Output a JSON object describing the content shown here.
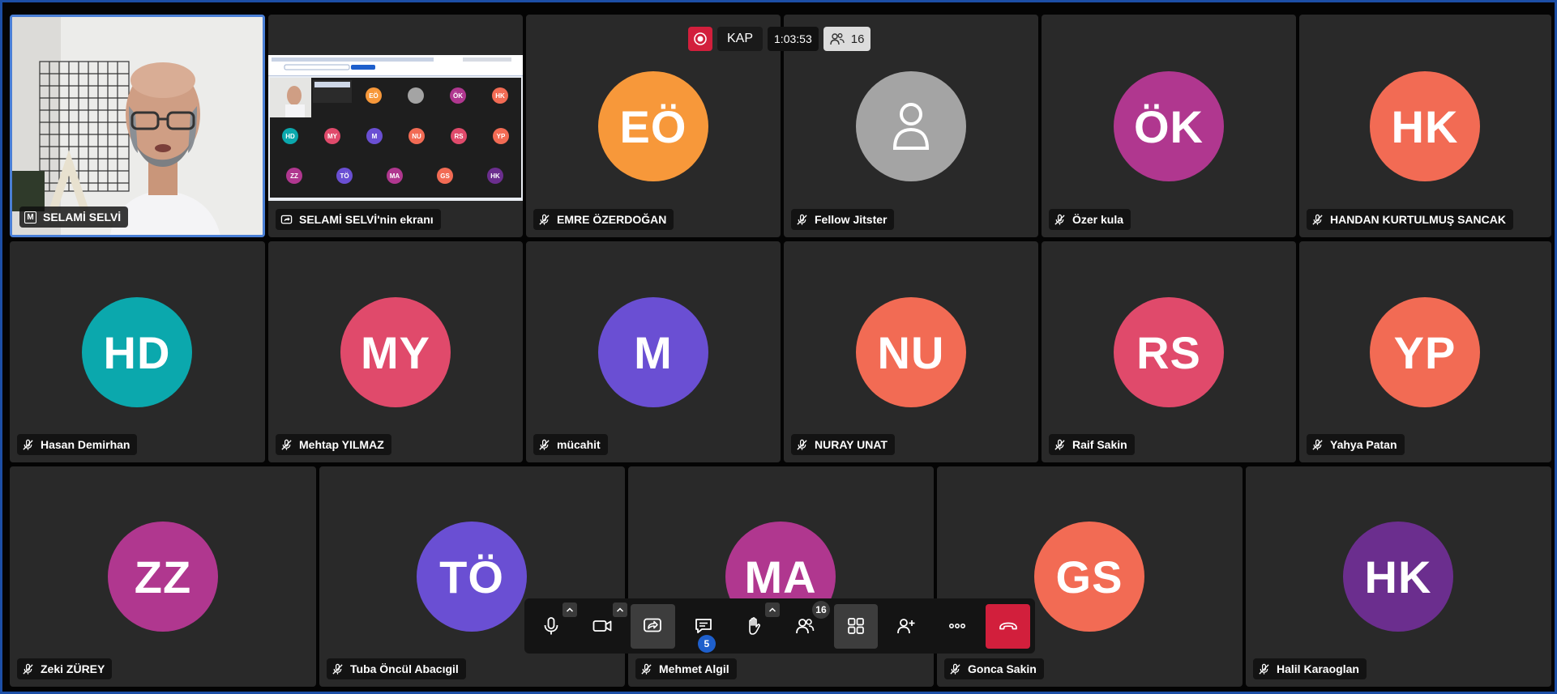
{
  "topbar": {
    "recording_label": "KAP",
    "elapsed": "1:03:53",
    "participant_count": "16"
  },
  "participants": [
    {
      "name": "SELAMİ SELVİ",
      "video": true
    },
    {
      "name": "SELAMİ SELVİ'nin ekranı",
      "screen_share": true
    },
    {
      "name": "EMRE ÖZERDOĞAN",
      "initials": "EÖ",
      "color": "#f7983a"
    },
    {
      "name": "Fellow Jitster",
      "placeholder": true,
      "color": "#a4a4a4"
    },
    {
      "name": "Özer kula",
      "initials": "ÖK",
      "color": "#b0378f"
    },
    {
      "name": "HANDAN KURTULMUŞ SANCAK",
      "initials": "HK",
      "color": "#f26b54"
    },
    {
      "name": "Hasan Demirhan",
      "initials": "HD",
      "color": "#0ba8ad"
    },
    {
      "name": "Mehtap YILMAZ",
      "initials": "MY",
      "color": "#e04a6b"
    },
    {
      "name": "mücahit",
      "initials": "M",
      "color": "#6a4fd3"
    },
    {
      "name": "NURAY UNAT",
      "initials": "NU",
      "color": "#f26b54"
    },
    {
      "name": "Raif Sakin",
      "initials": "RS",
      "color": "#e04a6b"
    },
    {
      "name": "Yahya Patan",
      "initials": "YP",
      "color": "#f26b54"
    },
    {
      "name": "Zeki ZÜREY",
      "initials": "ZZ",
      "color": "#b0378f"
    },
    {
      "name": "Tuba Öncül Abacıgil",
      "initials": "TÖ",
      "color": "#6a4fd3"
    },
    {
      "name": "Mehmet Algil",
      "initials": "MA",
      "color": "#b0378f"
    },
    {
      "name": "Gonca Sakin",
      "initials": "GS",
      "color": "#f26b54"
    },
    {
      "name": "Halil Karaoglan",
      "initials": "HK",
      "color": "#6b2e8e"
    }
  ],
  "screen_thumb": {
    "avatars": [
      {
        "t": "EÖ",
        "c": "#f7983a"
      },
      {
        "t": "",
        "c": "#a4a4a4"
      },
      {
        "t": "ÖK",
        "c": "#b0378f"
      },
      {
        "t": "HK",
        "c": "#f26b54"
      },
      {
        "t": "HD",
        "c": "#0ba8ad"
      },
      {
        "t": "MY",
        "c": "#e04a6b"
      },
      {
        "t": "M",
        "c": "#6a4fd3"
      },
      {
        "t": "NU",
        "c": "#f26b54"
      },
      {
        "t": "RS",
        "c": "#e04a6b"
      },
      {
        "t": "YP",
        "c": "#f26b54"
      },
      {
        "t": "ZZ",
        "c": "#b0378f"
      },
      {
        "t": "TÖ",
        "c": "#6a4fd3"
      },
      {
        "t": "MA",
        "c": "#b0378f"
      },
      {
        "t": "GS",
        "c": "#f26b54"
      },
      {
        "t": "HK",
        "c": "#6b2e8e"
      }
    ]
  },
  "toolbar": {
    "buttons": [
      "microphone",
      "camera",
      "screen-share",
      "chat",
      "raise-hand",
      "participants",
      "tile-view",
      "invite",
      "more",
      "hang-up"
    ],
    "chat_unread": "5",
    "participants_badge": "16"
  },
  "colors": {
    "recording": "#d21f3c",
    "hangup": "#d21f3c",
    "active_border": "#4a7fd6",
    "unread_badge": "#1e5fcc"
  }
}
